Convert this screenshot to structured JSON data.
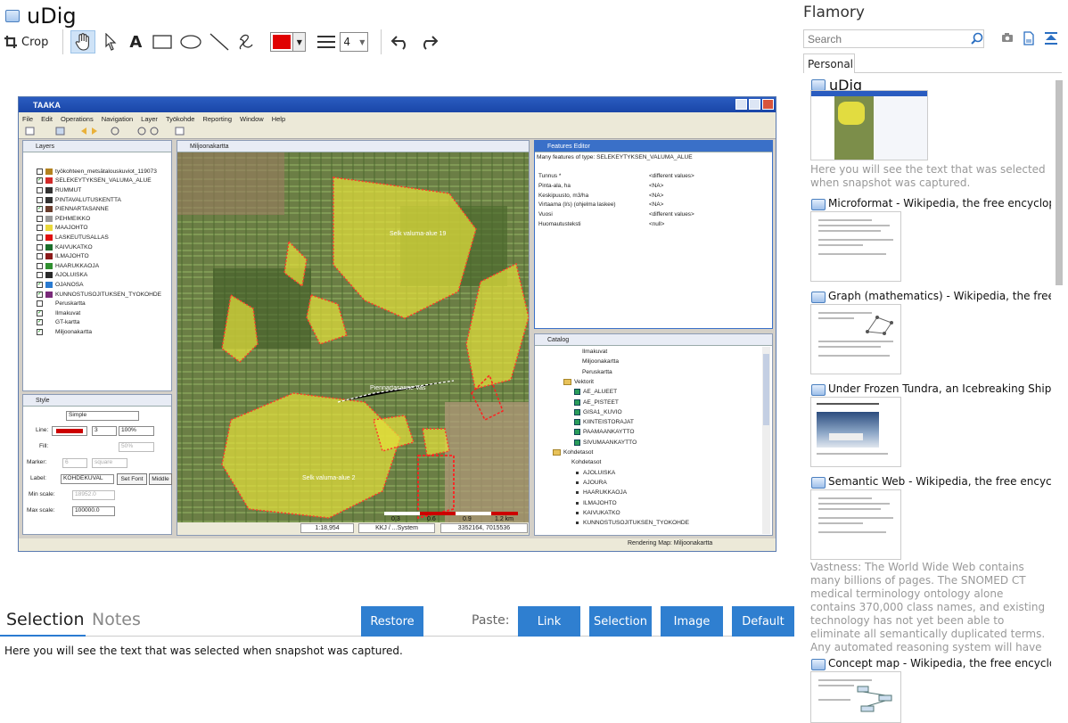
{
  "app": {
    "title": "uDig"
  },
  "toolbar": {
    "crop_label": "Crop",
    "line_width_value": "4",
    "draw_color": "#e00000"
  },
  "screenshot": {
    "window_title": "TAAKA",
    "menu": [
      "File",
      "Edit",
      "Operations",
      "Navigation",
      "Layer",
      "Työkohde",
      "Reporting",
      "Window",
      "Help"
    ],
    "layers_tab": "Layers",
    "layers": [
      {
        "label": "työkohteen_metsätalouskuviot_119073",
        "checked": false
      },
      {
        "label": "SELEKEYTYKSEN_VALUMA_ALUE",
        "checked": true
      },
      {
        "label": "RUMMUT",
        "checked": false
      },
      {
        "label": "PINTAVALUTUSKENTTA",
        "checked": false
      },
      {
        "label": "PIENNARTASANNE",
        "checked": true
      },
      {
        "label": "PEHMEIKKO",
        "checked": false
      },
      {
        "label": "MAAJOHTO",
        "checked": false
      },
      {
        "label": "LASKEUTUSALLAS",
        "checked": false
      },
      {
        "label": "KAIVUKATKO",
        "checked": false
      },
      {
        "label": "ILMAJOHTO",
        "checked": false
      },
      {
        "label": "HAARUKKAOJA",
        "checked": false
      },
      {
        "label": "AJOLUISKA",
        "checked": false
      },
      {
        "label": "OJANOSA",
        "checked": true
      },
      {
        "label": "KUNNOSTUSOJITUKSEN_TYOKOHDE",
        "checked": true
      },
      {
        "label": "Peruskartta",
        "checked": false
      },
      {
        "label": "Ilmakuvat",
        "checked": true
      },
      {
        "label": "GT-kartta",
        "checked": true
      },
      {
        "label": "Miljoonakartta",
        "checked": true
      }
    ],
    "style_tab": "Style",
    "style": {
      "preset": "Simple",
      "line_label": "Line:",
      "line_width": "3",
      "line_opacity": "100%",
      "fill_label": "Fill:",
      "fill_opacity": "50%",
      "marker_label": "Marker:",
      "marker_size": "6",
      "marker_shape": "square",
      "label_label": "Label:",
      "label_value": "KOHDEKUVAL",
      "set_font": "Set Font",
      "middle": "Middle",
      "min_scale_label": "Min scale:",
      "min_scale": "18952.0",
      "max_scale_label": "Max scale:",
      "max_scale": "100000.0"
    },
    "map_tab": "Miljoonakartta",
    "map_labels": [
      "Selk valuma-alue 19",
      "Selk valuma-alue 2",
      "Piennartasanne Vas"
    ],
    "scalebar": [
      "0.3",
      "0.6",
      "0.9",
      "1.2 km"
    ],
    "status": {
      "scale": "1:18,954",
      "crs": "KKJ / ...System",
      "coords": "3352164, 7015536"
    },
    "features_tab": "Features Editor",
    "features_header": "Many features of type: SELEKEYTYKSEN_VALUMA_ALUE",
    "features": [
      {
        "k": "Tunnus *",
        "v": "<different values>"
      },
      {
        "k": "Pinta-ala, ha",
        "v": "<NA>"
      },
      {
        "k": "Keskipuusto, m3/ha",
        "v": "<NA>"
      },
      {
        "k": "Virtaama (l/s) (ohjelma laskee)",
        "v": "<NA>"
      },
      {
        "k": "Vuosi",
        "v": "<different values>"
      },
      {
        "k": "Huomautusteksti",
        "v": "<null>"
      }
    ],
    "catalog_tab": "Catalog",
    "catalog": [
      {
        "label": "Ilmakuvat",
        "indent": 3,
        "kind": "plain"
      },
      {
        "label": "Miljoonakartta",
        "indent": 3,
        "kind": "plain"
      },
      {
        "label": "Peruskartta",
        "indent": 3,
        "kind": "plain"
      },
      {
        "label": "Vektorit",
        "indent": 2,
        "kind": "folder"
      },
      {
        "label": "AE_ALUEET",
        "indent": 3,
        "kind": "green"
      },
      {
        "label": "AE_PISTEET",
        "indent": 3,
        "kind": "green"
      },
      {
        "label": "GISA1_KUVIO",
        "indent": 3,
        "kind": "green"
      },
      {
        "label": "KIINTEISTORAJAT",
        "indent": 3,
        "kind": "green"
      },
      {
        "label": "PAAMAANKAYTTO",
        "indent": 3,
        "kind": "green"
      },
      {
        "label": "SIVUMAANKAYTTO",
        "indent": 3,
        "kind": "green"
      },
      {
        "label": "Kohdetasot",
        "indent": 1,
        "kind": "folder"
      },
      {
        "label": "Kohdetasot",
        "indent": 2,
        "kind": "plain"
      },
      {
        "label": "AJOLUISKA",
        "indent": 3,
        "kind": "dot"
      },
      {
        "label": "AJOURA",
        "indent": 3,
        "kind": "dot"
      },
      {
        "label": "HAARUKKAOJA",
        "indent": 3,
        "kind": "dot"
      },
      {
        "label": "ILMAJOHTO",
        "indent": 3,
        "kind": "dot"
      },
      {
        "label": "KAIVUKATKO",
        "indent": 3,
        "kind": "dot"
      },
      {
        "label": "KUNNOSTUSOJITUKSEN_TYOKOHDE",
        "indent": 3,
        "kind": "dot"
      }
    ],
    "bottom_status": "Rendering Map: Miljoonakartta"
  },
  "tabs": {
    "selection": "Selection",
    "notes": "Notes"
  },
  "buttons": {
    "restore": "Restore",
    "paste_label": "Paste:",
    "link": "Link",
    "selection": "Selection",
    "image": "Image",
    "default": "Default"
  },
  "selection_text": "Here you will see the text that was selected when snapshot was captured.",
  "sidebar": {
    "title": "Flamory",
    "search_placeholder": "Search",
    "tab": "Personal",
    "entries": [
      {
        "title": "uDig",
        "desc": "Here you will see the text that was selected when snapshot was captured."
      },
      {
        "title": "Microformat - Wikipedia, the free encyclopedia",
        "desc": ""
      },
      {
        "title": "Graph (mathematics) - Wikipedia, the free ency",
        "desc": ""
      },
      {
        "title": "Under Frozen Tundra, an Icebreaking Ship Unco",
        "desc": ""
      },
      {
        "title": "Semantic Web - Wikipedia, the free encycloped",
        "desc": "Vastness: The World Wide Web contains many billions of pages. The SNOMED CT medical terminology ontology alone contains 370,000 class names, and existing technology has not yet been able to eliminate all semantically duplicated terms. Any automated reasoning system will have to deal with truly huge inputs."
      },
      {
        "title": "Concept map - Wikipedia, the free encyclopedi",
        "desc": ""
      }
    ]
  }
}
